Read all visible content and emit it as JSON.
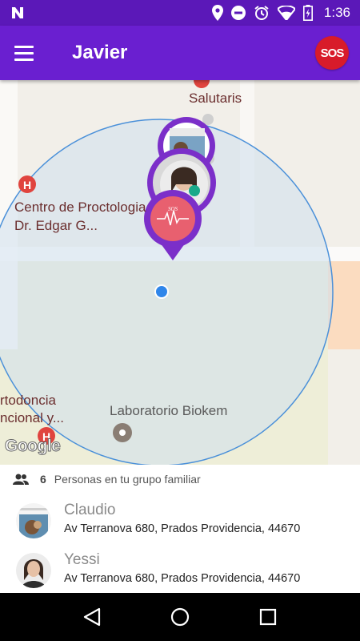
{
  "status_bar": {
    "time": "1:36",
    "icons": [
      "notification-n-icon",
      "location-icon",
      "do-not-disturb-icon",
      "alarm-icon",
      "wifi-icon",
      "battery-charging-icon"
    ]
  },
  "app_bar": {
    "title": "Javier",
    "sos_label": "SOS",
    "menu_icon": "hamburger-menu-icon"
  },
  "map": {
    "pois": {
      "salutaris": "Salutaris",
      "proctologia_line1": "Centro de Proctologia",
      "proctologia_line2": "Dr. Edgar G...",
      "ortodoncia_line1": "rtodoncia",
      "ortodoncia_line2": "ncional y...",
      "laboratorio": "Laboratorio Biokem"
    },
    "attribution": "Google",
    "colors": {
      "geofence_fill": "#cfe0ef",
      "geofence_stroke": "#4a90d9",
      "marker_purple": "#7b2fc9",
      "marker_pink": "#e8606f",
      "user_dot": "#2f86ea"
    }
  },
  "family_panel": {
    "count": "6",
    "label": "Personas en tu grupo familiar",
    "members": [
      {
        "name": "Claudio",
        "address": "Av Terranova 680, Prados Providencia, 44670"
      },
      {
        "name": "Yessi",
        "address": "Av Terranova 680, Prados Providencia, 44670"
      }
    ]
  },
  "nav_bar": {
    "icons": [
      "back-icon",
      "home-icon",
      "recents-icon"
    ]
  }
}
